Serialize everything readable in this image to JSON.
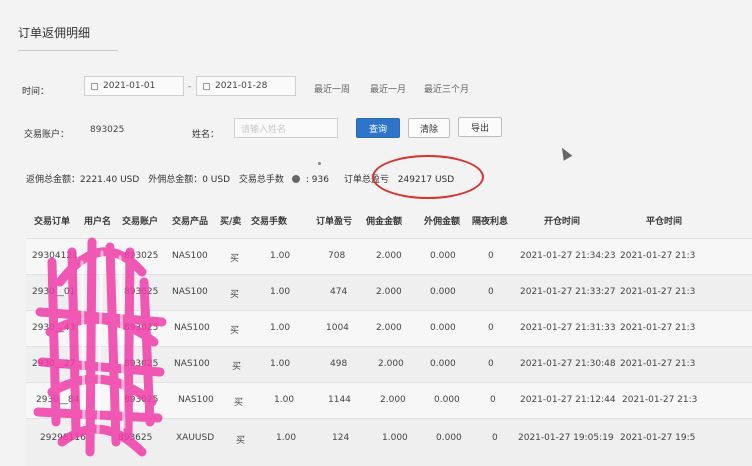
{
  "page": {
    "title": "订单返佣明细"
  },
  "filters": {
    "time_label": "时间：",
    "start_date": "2021-01-01",
    "end_date": "2021-01-28",
    "range_separator": "-",
    "quick_ranges": [
      "最近一周",
      "最近一月",
      "最近三个月"
    ],
    "account_label": "交易账户：",
    "account_value": "893025",
    "name_label": "姓名：",
    "name_placeholder": "请输入姓名"
  },
  "buttons": {
    "search": "查询",
    "clear": "清除",
    "export": "导出"
  },
  "summary": {
    "rebate_total": "返佣总金额：2221.40 USD",
    "ext_total": "外佣总金额：0 USD",
    "lots_label": "交易总手数",
    "lots_value": ": 936",
    "pnl_label": "订单总盈亏",
    "pnl_value": "249217 USD"
  },
  "table": {
    "headers": [
      "交易订单",
      "用户名",
      "交易账户",
      "交易产品",
      "买/卖",
      "交易手数",
      "订单盈亏",
      "佣金金额",
      "外佣金额",
      "隔夜利息",
      "开仓时间",
      "平仓时间"
    ],
    "rows": [
      [
        "29304121",
        "",
        "893025",
        "NAS100",
        "买",
        "1.00",
        "708",
        "2.000",
        "0.000",
        "0",
        "2021-01-27 21:34:23",
        "2021-01-27 21:3"
      ],
      [
        "2930__01",
        "",
        "893025",
        "NAS100",
        "买",
        "1.00",
        "474",
        "2.000",
        "0.000",
        "0",
        "2021-01-27 21:33:27",
        "2021-01-27 21:3"
      ],
      [
        "2930__43",
        "",
        "893025",
        "NAS100",
        "买",
        "1.00",
        "1004",
        "2.000",
        "0.000",
        "0",
        "2021-01-27 21:31:33",
        "2021-01-27 21:3"
      ],
      [
        "2930__27",
        "",
        "893025",
        "NAS100",
        "买",
        "1.00",
        "498",
        "2.000",
        "0.000",
        "0",
        "2021-01-27 21:30:48",
        "2021-01-27 21:3"
      ],
      [
        "2930__84",
        "",
        "893025",
        "NAS100",
        "买",
        "1.00",
        "1144",
        "2.000",
        "0.000",
        "0",
        "2021-01-27 21:12:44",
        "2021-01-27 21:3"
      ],
      [
        "29298116",
        "",
        "893625",
        "XAUUSD",
        "买",
        "1.00",
        "124",
        "1.000",
        "0.000",
        "0",
        "2021-01-27 19:05:19",
        "2021-01-27 19:5"
      ]
    ]
  },
  "colors": {
    "primary": "#2f74c9",
    "annotation": "#d9312b",
    "scribble": "#f03ca8"
  }
}
